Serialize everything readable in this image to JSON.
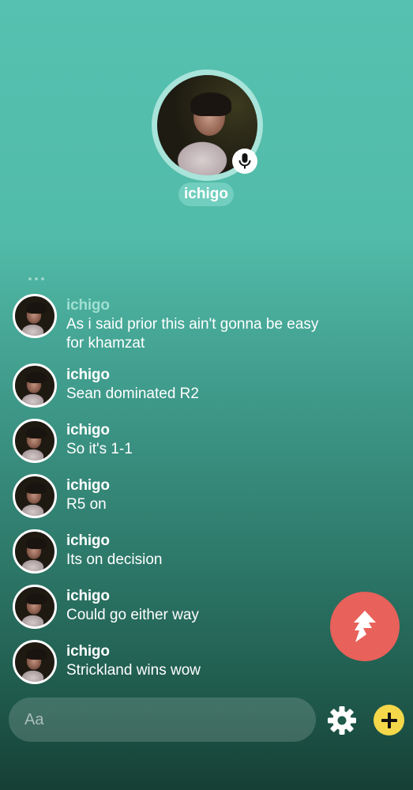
{
  "host": {
    "name": "ichigo",
    "mic_icon": "microphone-icon"
  },
  "messages": [
    {
      "author": "ichigo",
      "text": "As i said prior this ain't gonna be easy for khamzat",
      "faded": true
    },
    {
      "author": "ichigo",
      "text": "Sean dominated R2"
    },
    {
      "author": "ichigo",
      "text": "So it's 1-1"
    },
    {
      "author": "ichigo",
      "text": "R5 on"
    },
    {
      "author": "ichigo",
      "text": "Its on decision"
    },
    {
      "author": "ichigo",
      "text": "Could go either way"
    },
    {
      "author": "ichigo",
      "text": "Strickland wins wow"
    }
  ],
  "composer": {
    "placeholder": "Aa"
  },
  "icons": {
    "fab": "lightning-share-icon",
    "settings": "gear-icon",
    "add": "plus-icon"
  },
  "colors": {
    "background_top": "#56c1b0",
    "background_bottom": "#163f35",
    "fab": "#e8615a",
    "add_button": "#f5d74a"
  }
}
